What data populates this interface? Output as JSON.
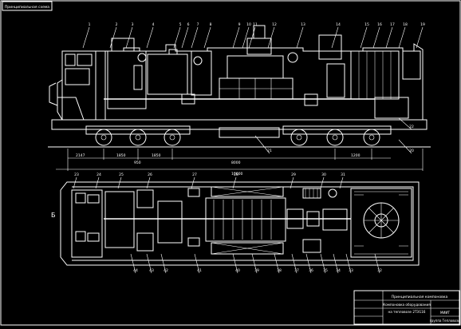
{
  "title_stamp": "Принципиальная схема",
  "title_block": {
    "drawing_title": "Принципиальная компоновка",
    "drawing_subtitle_1": "Компоновка оборудования",
    "drawing_subtitle_2": "на тепловозе 2ТЭ116",
    "organization_1": "МИИТ",
    "organization_2": "группа Тепловозы"
  },
  "dimensions": {
    "d1": "2147",
    "d2": "1850",
    "d3": "1850",
    "d4": "950",
    "d5": "8000",
    "d6": "10000",
    "d7": "1200"
  },
  "labels_top": [
    "1",
    "2",
    "3",
    "4",
    "5",
    "6",
    "7",
    "8",
    "9",
    "10",
    "11",
    "12",
    "13",
    "14",
    "15",
    "16",
    "17",
    "18",
    "19"
  ],
  "labels_side": [
    "20",
    "21",
    "22"
  ],
  "labels_plan_top": [
    "23",
    "24",
    "25",
    "26",
    "27",
    "28",
    "29",
    "30",
    "31"
  ],
  "labels_plan_bottom": [
    "32",
    "33",
    "34",
    "35",
    "36",
    "37",
    "38",
    "39",
    "40",
    "41",
    "42",
    "43",
    "44"
  ],
  "plan_side_label": "Б"
}
